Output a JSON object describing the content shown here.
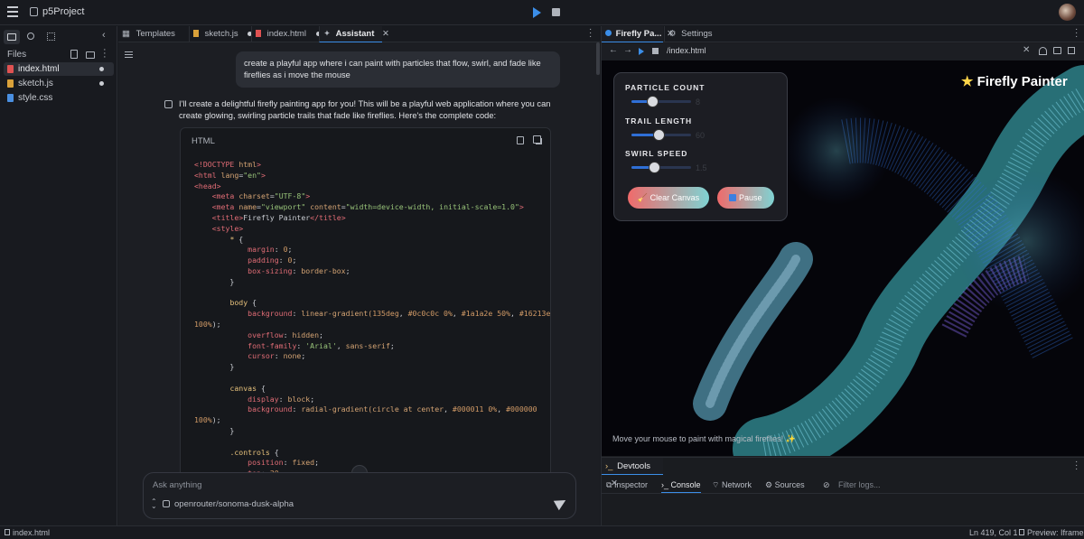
{
  "app": {
    "project_name": "p5Project"
  },
  "sidebar": {
    "title": "Files",
    "files": [
      {
        "name": "index.html",
        "active": true,
        "modified": true,
        "color": "#e05252"
      },
      {
        "name": "sketch.js",
        "active": false,
        "modified": true,
        "color": "#d9a13a"
      },
      {
        "name": "style.css",
        "active": false,
        "modified": false,
        "color": "#4a8fe0"
      }
    ]
  },
  "editor_tabs": [
    {
      "label": "Templates",
      "modified": false
    },
    {
      "label": "sketch.js",
      "modified": true
    },
    {
      "label": "index.html",
      "modified": true
    },
    {
      "label": "Assistant",
      "active": true
    }
  ],
  "chat": {
    "user_message": "create a playful app where i can paint with particles that flow, swirl, and fade like fireflies as i move the mouse",
    "assistant_message": "I'll create a delightful firefly painting app for you! This will be a playful web application where you can create glowing, swirling particle trails that fade like fireflies. Here's the complete code:",
    "code_lang": "HTML",
    "input_placeholder": "Ask anything",
    "model": "openrouter/sonoma-dusk-alpha"
  },
  "preview_tabs": [
    {
      "label": "Firefly Pa...",
      "active": true
    },
    {
      "label": "Settings",
      "active": false
    }
  ],
  "preview": {
    "url": "/index.html",
    "app_title": "Firefly Painter",
    "controls": {
      "particle_count_label": "PARTICLE COUNT",
      "particle_count_value": "8",
      "particle_count_fraction": 0.2,
      "trail_length_label": "TRAIL LENGTH",
      "trail_length_value": "60",
      "trail_length_fraction": 0.43,
      "swirl_speed_label": "SWIRL SPEED",
      "swirl_speed_value": "1.5",
      "swirl_speed_fraction": 0.35,
      "clear_label": "Clear Canvas",
      "pause_label": "Pause"
    },
    "hint": "Move your mouse to paint with magical fireflies! ✨"
  },
  "devtools": {
    "title": "Devtools",
    "tabs": [
      "Inspector",
      "Console",
      "Network",
      "Sources"
    ],
    "active_tab": "Console",
    "filter_placeholder": "Filter logs..."
  },
  "status": {
    "file": "index.html",
    "position": "Ln 419, Col 1",
    "preview_mode": "Preview: Iframe"
  }
}
